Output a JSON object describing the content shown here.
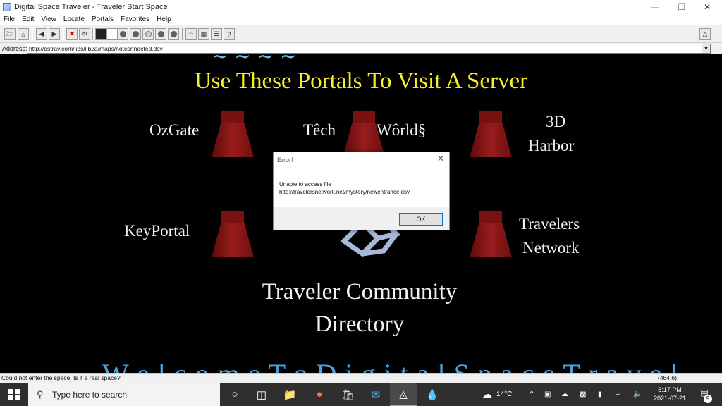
{
  "window": {
    "title": "Digital Space Traveler - Traveler Start Space",
    "min_icon": "minimize-icon",
    "max_icon": "maximize-icon",
    "close_icon": "close-icon"
  },
  "menu": {
    "items": [
      "File",
      "Edit",
      "View",
      "Locate",
      "Portals",
      "Favorites",
      "Help"
    ]
  },
  "address": {
    "label": "Address:",
    "url": "http://dstrav.com/libs/lib2a/maps/notconnected.dsv"
  },
  "scene": {
    "headline": "Use These Portals To Visit A Server",
    "portals": {
      "ozgate": "OzGate",
      "tech": "Têch",
      "world": "Wôrld§",
      "harbor_line1": "3D",
      "harbor_line2": "Harbor",
      "keyportal": "KeyPortal",
      "travelers_line1": "Travelers",
      "travelers_line2": "Network"
    },
    "directory_line1": "Traveler Community",
    "directory_line2": "Directory",
    "portal_color": "#8b1515",
    "headline_color": "#f7ef2a"
  },
  "dialog": {
    "title": "Error!",
    "message_line1": "Unable to access file",
    "message_line2": "http://travelersnetwork.net/mystery/newentrance.dsv",
    "ok_label": "OK"
  },
  "status": {
    "text": "Could not enter the space. Is it a real space?",
    "coord": "(464.6)"
  },
  "taskbar": {
    "search_placeholder": "Type here to search",
    "weather": "14°C",
    "time": "5:17 PM",
    "date": "2021-07-21",
    "notification_count": "9"
  }
}
